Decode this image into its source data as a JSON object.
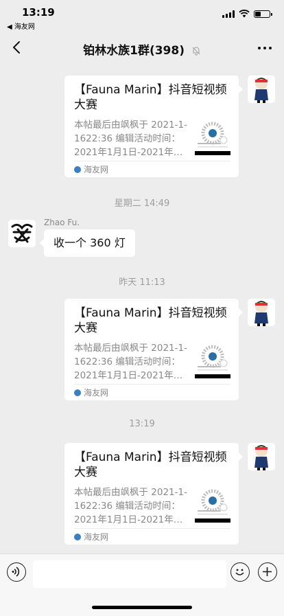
{
  "status_bar": {
    "time": "13:19",
    "back_app": "◀ 海友网"
  },
  "nav": {
    "title": "铂林水族1群(398)"
  },
  "messages": [
    {
      "type": "card",
      "title": "【Fauna Marin】抖音短视频大赛",
      "desc": "本帖最后由飒枫于 2021-1-1622:36 编辑活动时间：2021年1月1日-2021年…",
      "source": "海友网"
    },
    {
      "type": "timestamp",
      "text": "星期二 14:49"
    },
    {
      "type": "text",
      "sender": "Zhao Fu.",
      "text": "收一个 360 灯"
    },
    {
      "type": "timestamp",
      "text": "昨天 11:13"
    },
    {
      "type": "card",
      "title": "【Fauna Marin】抖音短视频大赛",
      "desc": "本帖最后由飒枫于 2021-1-1622:36 编辑活动时间：2021年1月1日-2021年…",
      "source": "海友网"
    },
    {
      "type": "timestamp",
      "text": "13:19"
    },
    {
      "type": "card",
      "title": "【Fauna Marin】抖音短视频大赛",
      "desc": "本帖最后由飒枫于 2021-1-1622:36 编辑活动时间：2021年1月1日-2021年…",
      "source": "海友网"
    }
  ],
  "input": {
    "placeholder": ""
  },
  "colors": {
    "background": "#ededed",
    "bubble": "#ffffff",
    "timestamp": "#9d9d9d",
    "source_dot": "#3a7fc1"
  },
  "icons": [
    "back-icon",
    "mute-icon",
    "more-icon",
    "voice-icon",
    "emoji-icon",
    "plus-icon"
  ]
}
